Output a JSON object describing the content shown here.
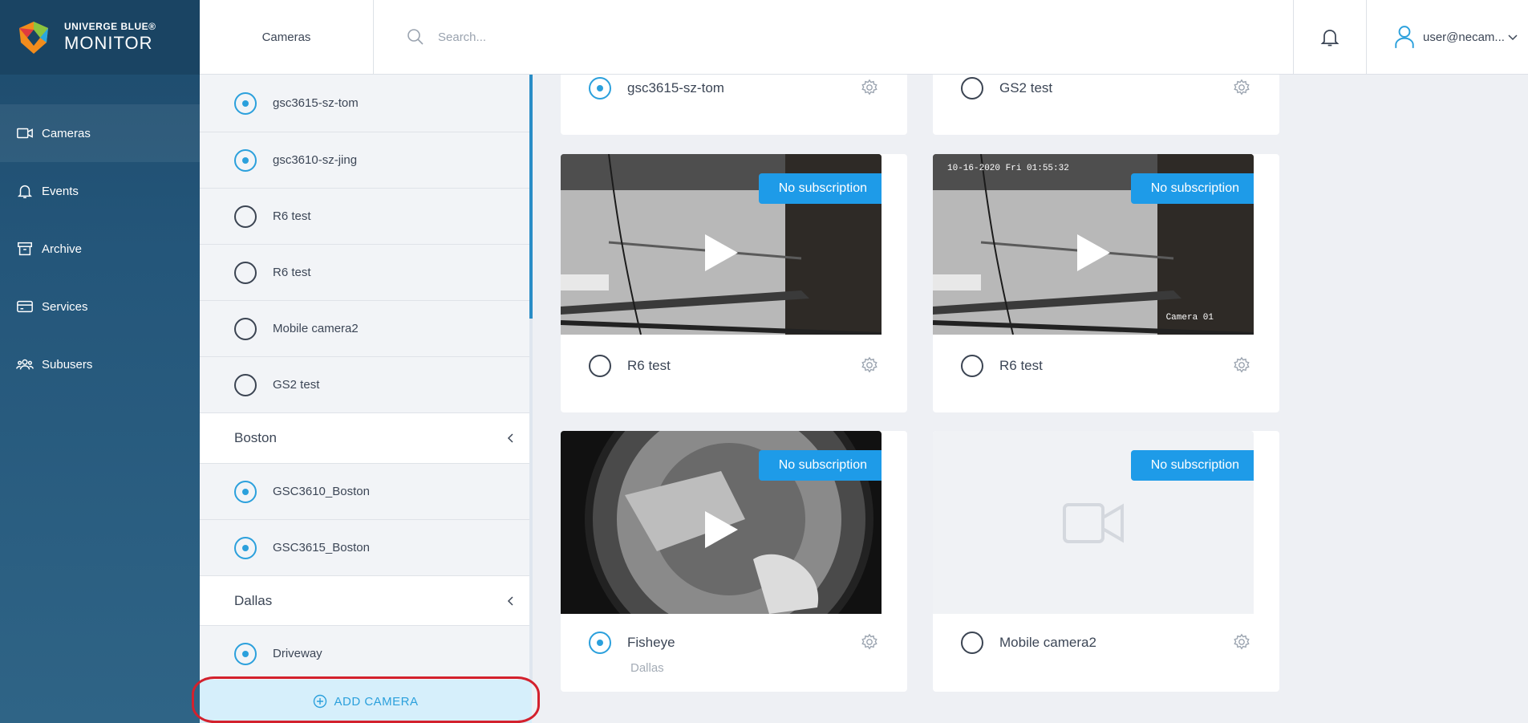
{
  "brand": {
    "line1": "UNIVERGE BLUE®",
    "line2": "MONITOR"
  },
  "nav": [
    {
      "label": "Cameras",
      "icon": "camera-icon",
      "active": true
    },
    {
      "label": "Events",
      "icon": "bell-icon"
    },
    {
      "label": "Archive",
      "icon": "archive-icon"
    },
    {
      "label": "Services",
      "icon": "card-icon"
    },
    {
      "label": "Subusers",
      "icon": "users-icon"
    }
  ],
  "topbar": {
    "title": "Cameras",
    "search_placeholder": "Search...",
    "user": "user@necam..."
  },
  "list": {
    "rows_top": [
      {
        "label": "gsc3615-sz-tom",
        "selected": true
      },
      {
        "label": "gsc3610-sz-jing",
        "selected": true
      },
      {
        "label": "R6 test",
        "selected": false
      },
      {
        "label": "R6 test",
        "selected": false
      },
      {
        "label": "Mobile camera2",
        "selected": false
      },
      {
        "label": "GS2 test",
        "selected": false
      }
    ],
    "boston": {
      "group": "Boston",
      "rows": [
        {
          "label": "GSC3610_Boston",
          "selected": true
        },
        {
          "label": "GSC3615_Boston",
          "selected": true
        }
      ]
    },
    "dallas": {
      "group": "Dallas",
      "rows": [
        {
          "label": "Driveway",
          "selected": true
        }
      ]
    },
    "add_label": "ADD CAMERA"
  },
  "cards": {
    "c1": {
      "name": "gsc3615-sz-tom",
      "selected": true
    },
    "c2": {
      "name": "GS2 test",
      "selected": false
    },
    "c3": {
      "name": "R6 test",
      "badge": "No subscription",
      "selected": false
    },
    "c4": {
      "name": "R6 test",
      "badge": "No subscription",
      "selected": false,
      "osd_time": "10-16-2020 Fri 01:55:32",
      "osd_name": "Camera 01"
    },
    "c5": {
      "name": "Fisheye",
      "location": "Dallas",
      "badge": "No subscription",
      "selected": true
    },
    "c6": {
      "name": "Mobile camera2",
      "badge": "No subscription",
      "selected": false
    }
  },
  "colors": {
    "accent": "#2ba0dc",
    "badge": "#1e9be8",
    "nav": "#1d4a6b"
  }
}
